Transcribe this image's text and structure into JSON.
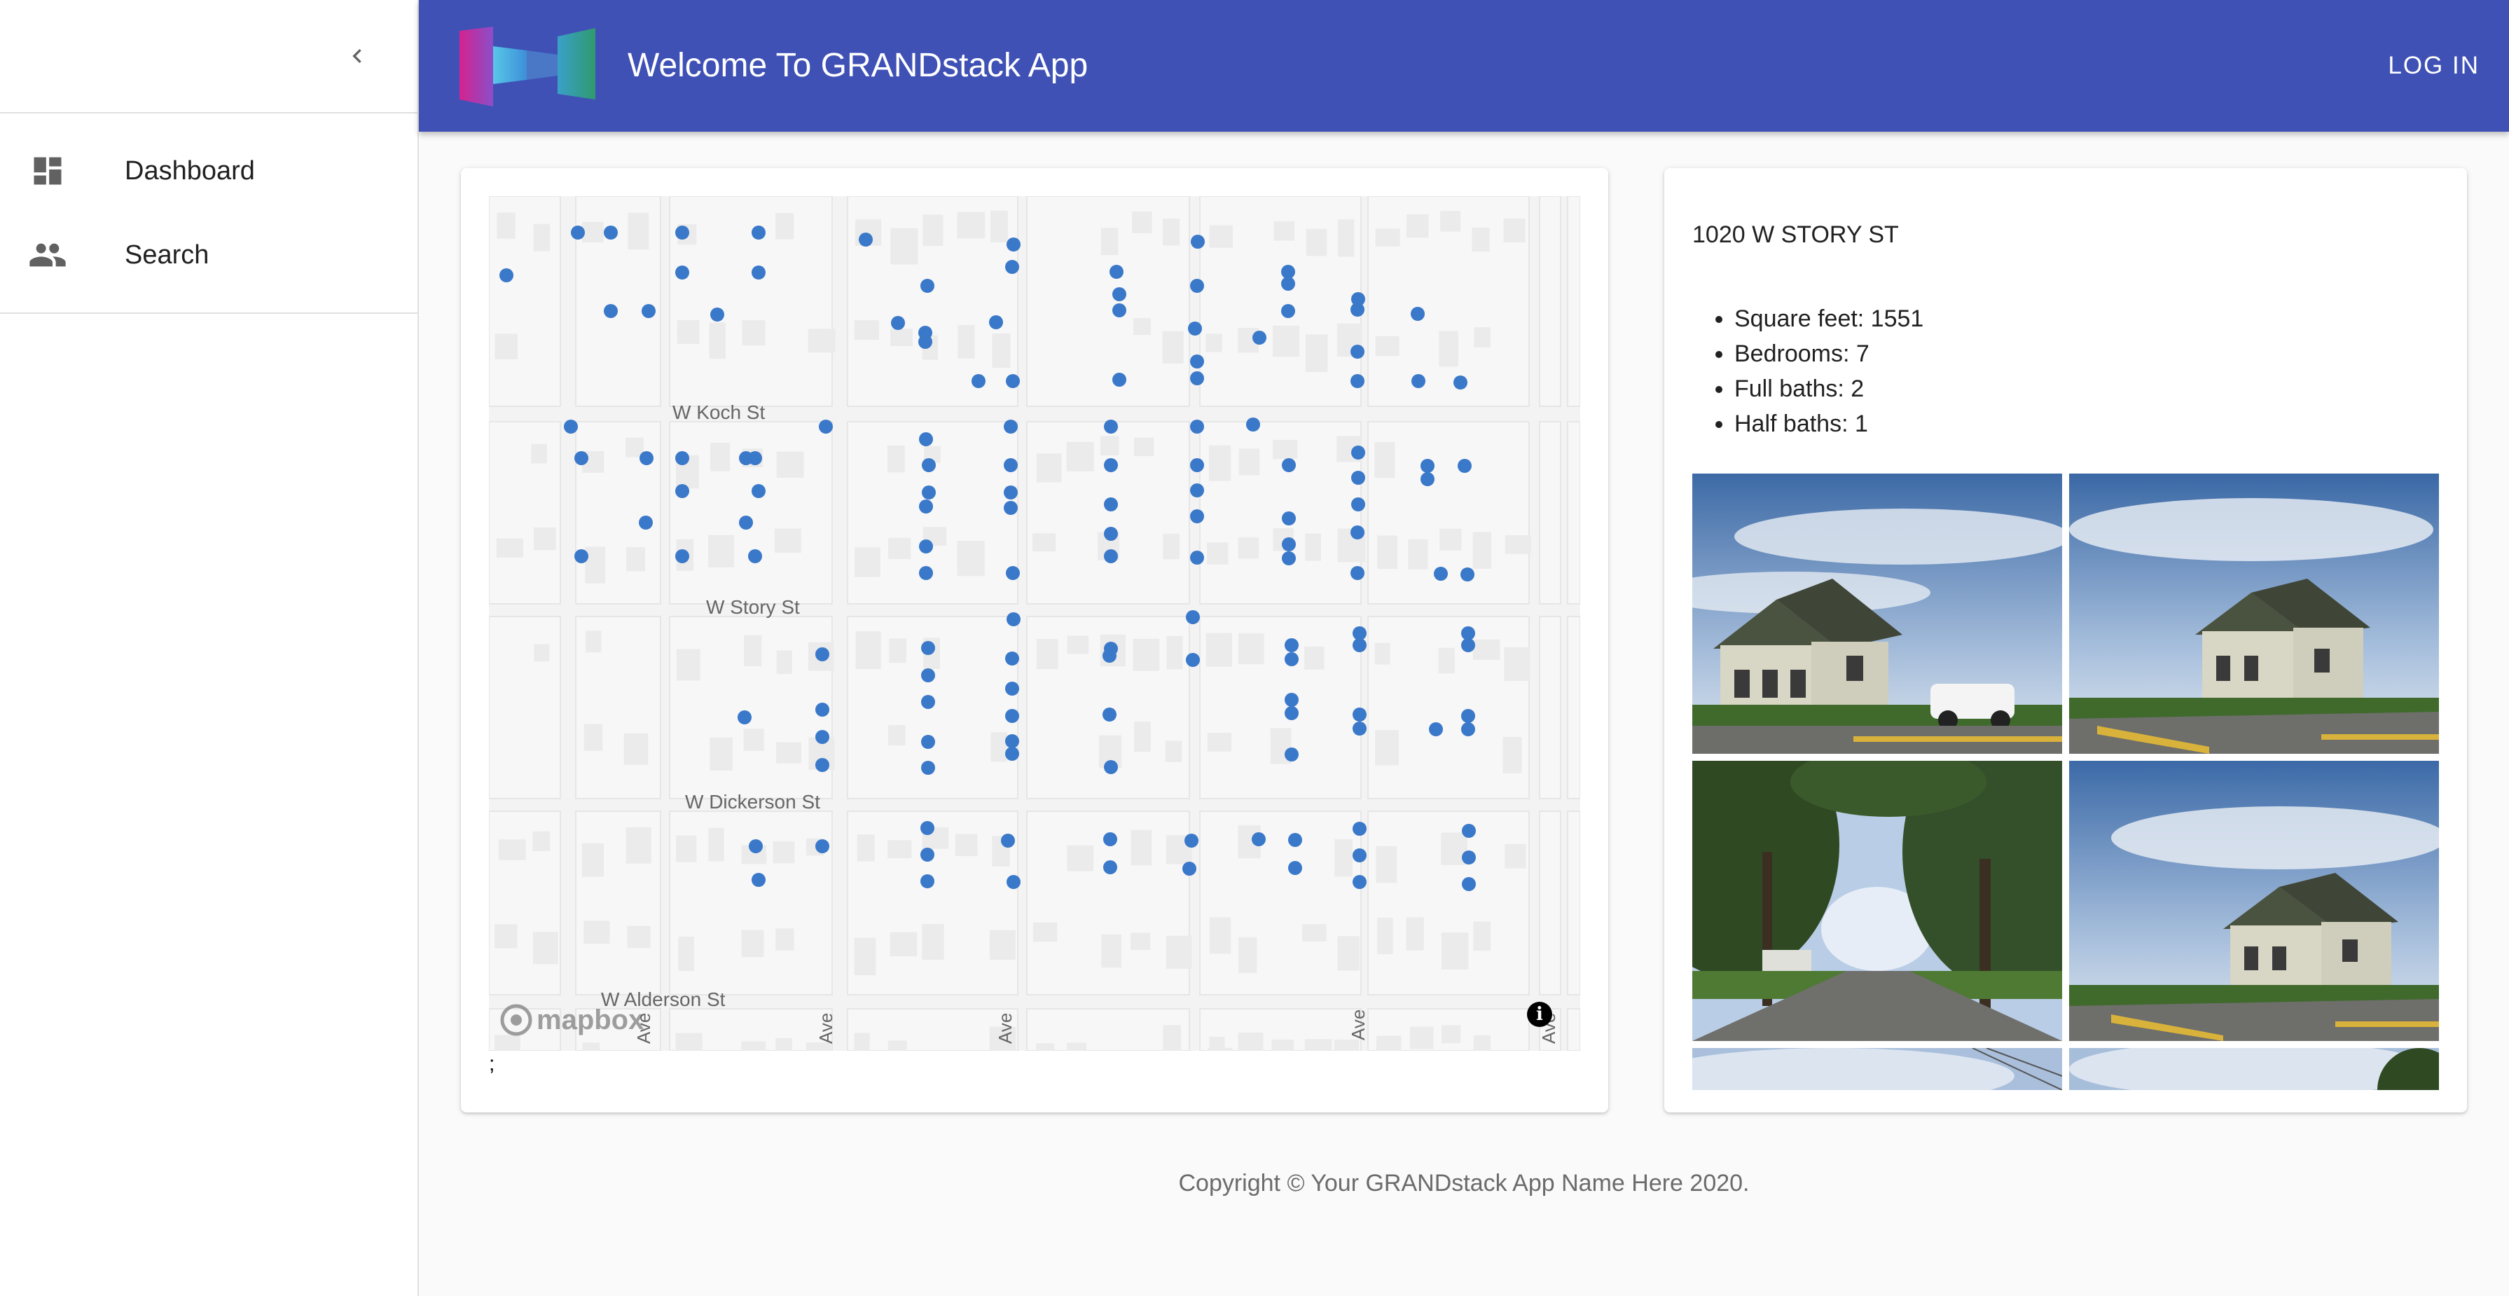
{
  "app": {
    "title": "Welcome To GRANDstack App",
    "login_label": "LOG IN",
    "brand_color": "#3f51b5"
  },
  "sidebar": {
    "collapse_icon": "chevron-left-icon",
    "items": [
      {
        "label": "Dashboard",
        "icon": "dashboard-icon"
      },
      {
        "label": "Search",
        "icon": "people-icon"
      }
    ]
  },
  "map": {
    "streets": [
      "W Koch St",
      "W Story St",
      "W Dickerson St",
      "W Alderson St"
    ],
    "avenue_label": "Ave",
    "attribution_logo": "mapbox",
    "info_icon": "info-icon",
    "marker_color": "#3a78c9",
    "trailing_text": ";"
  },
  "property": {
    "address": "1020 W STORY ST",
    "features": [
      "Square feet: 1551",
      "Bedrooms: 7",
      "Full baths: 2",
      "Half baths: 1"
    ]
  },
  "footer": {
    "copyright": "Copyright © Your GRANDstack App Name Here 2020."
  }
}
